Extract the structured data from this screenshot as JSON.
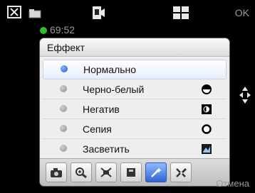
{
  "top": {
    "ok_label": "OK",
    "rec_time": "69:52"
  },
  "panel": {
    "title": "Еффект",
    "items": [
      {
        "label": "Нормально",
        "selected": true,
        "icon": "none"
      },
      {
        "label": "Черно-белый",
        "selected": false,
        "icon": "half-circle-icon"
      },
      {
        "label": "Негатив",
        "selected": false,
        "icon": "negative-icon"
      },
      {
        "label": "Сепия",
        "selected": false,
        "icon": "ring-icon"
      },
      {
        "label": "Засветить",
        "selected": false,
        "icon": "exposure-icon"
      }
    ]
  },
  "toolbar": {
    "buttons": [
      {
        "icon": "camera-mode-icon",
        "active": false
      },
      {
        "icon": "zoom-icon",
        "active": false
      },
      {
        "icon": "white-balance-icon",
        "active": false
      },
      {
        "icon": "storage-icon",
        "active": false
      },
      {
        "icon": "effect-wand-icon",
        "active": true
      },
      {
        "icon": "settings-tools-icon",
        "active": false
      }
    ]
  },
  "bottom": {
    "cancel_label": "Отмена"
  },
  "colors": {
    "panel_bg": "#eeeeee",
    "accent_blue": "#2e67d3",
    "rec_green": "#2bbf2b"
  }
}
